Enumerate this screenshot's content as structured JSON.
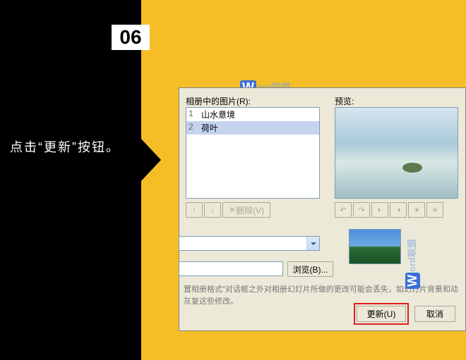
{
  "step": {
    "number": "06",
    "instruction": "点击“更新”按钮。"
  },
  "dialog": {
    "labels": {
      "pictures_in_album": "相册中的图片(R):",
      "preview": "预览:"
    },
    "list": {
      "items": [
        {
          "num": "1",
          "name": "山水意境",
          "selected": false
        },
        {
          "num": "2",
          "name": "荷叶",
          "selected": true
        }
      ]
    },
    "remove_button": "删除(V)",
    "browse": "浏览(B)...",
    "note": "置相册格式\"对话框之外对相册幻灯片所做的更改可能会丢失，如幻灯片背景和动灰复这些修改。",
    "update": "更新(U)",
    "cancel": "取消"
  },
  "watermark": {
    "text": "ord联盟",
    "badge": "W"
  }
}
